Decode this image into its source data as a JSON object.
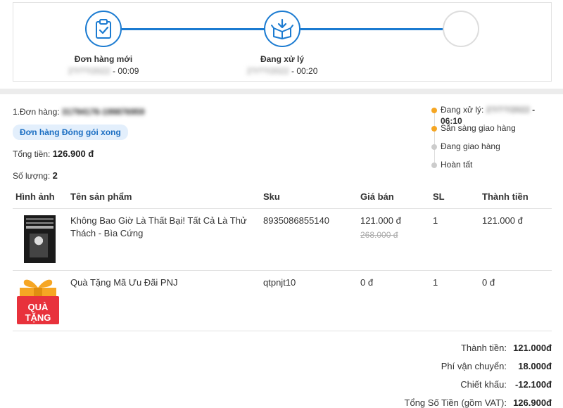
{
  "progress": {
    "steps": [
      {
        "label": "Đơn hàng mới",
        "date": "2?/??/2022",
        "time": " - 00:09",
        "state": "done",
        "icon": "clipboard-check-icon"
      },
      {
        "label": "Đang xử lý",
        "date": "2?/??/2022",
        "time": " - 00:20",
        "state": "done",
        "icon": "box-download-icon"
      },
      {
        "label": "",
        "date": "",
        "time": "",
        "state": "pending",
        "icon": ""
      }
    ]
  },
  "order": {
    "code_label": "1.Đơn hàng: ",
    "code_value": "31794176-199876959",
    "status_badge": "Đơn hàng Đóng gói xong",
    "total_label": "Tổng tiền: ",
    "total_value": "126.900 đ",
    "qty_label": "Số lượng: ",
    "qty_value": "2"
  },
  "timeline": {
    "items": [
      {
        "label": "Đang xử lý: ",
        "date": "2?/??/2022",
        "time": " - 06:10",
        "active": true
      },
      {
        "label": "Sẵn sàng giao hàng",
        "active": true
      },
      {
        "label": "Đang giao hàng",
        "active": false
      },
      {
        "label": "Hoàn tất",
        "active": false
      }
    ]
  },
  "table": {
    "headers": [
      "Hình ảnh",
      "Tên sản phẩm",
      "Sku",
      "Giá bán",
      "SL",
      "Thành tiền"
    ],
    "rows": [
      {
        "image": "book-cover",
        "name": "Không Bao Giờ Là Thất Bại! Tất Cả Là Thử Thách - Bìa Cứng",
        "sku": "8935086855140",
        "price": "121.000 đ",
        "old_price": "268.000 đ",
        "qty": "1",
        "total": "121.000 đ"
      },
      {
        "image": "gift-box",
        "name": "Quà Tặng Mã Ưu Đãi PNJ",
        "sku": "qtpnjt10",
        "price": "0 đ",
        "old_price": "",
        "qty": "1",
        "total": "0 đ"
      }
    ]
  },
  "gift_image_text": [
    "QUÀ",
    "TẶNG"
  ],
  "summary": [
    {
      "label": "Thành tiền:",
      "value": "121.000đ"
    },
    {
      "label": "Phí vận chuyển:",
      "value": "18.000đ"
    },
    {
      "label": "Chiết khấu:",
      "value": "-12.100đ"
    },
    {
      "label": "Tổng Số Tiền (gồm VAT):",
      "value": "126.900đ"
    }
  ],
  "colors": {
    "accent": "#1b7bd1",
    "timeline_active": "#f5a623",
    "gift_red": "#e8323c",
    "gift_ribbon": "#f6a623"
  }
}
